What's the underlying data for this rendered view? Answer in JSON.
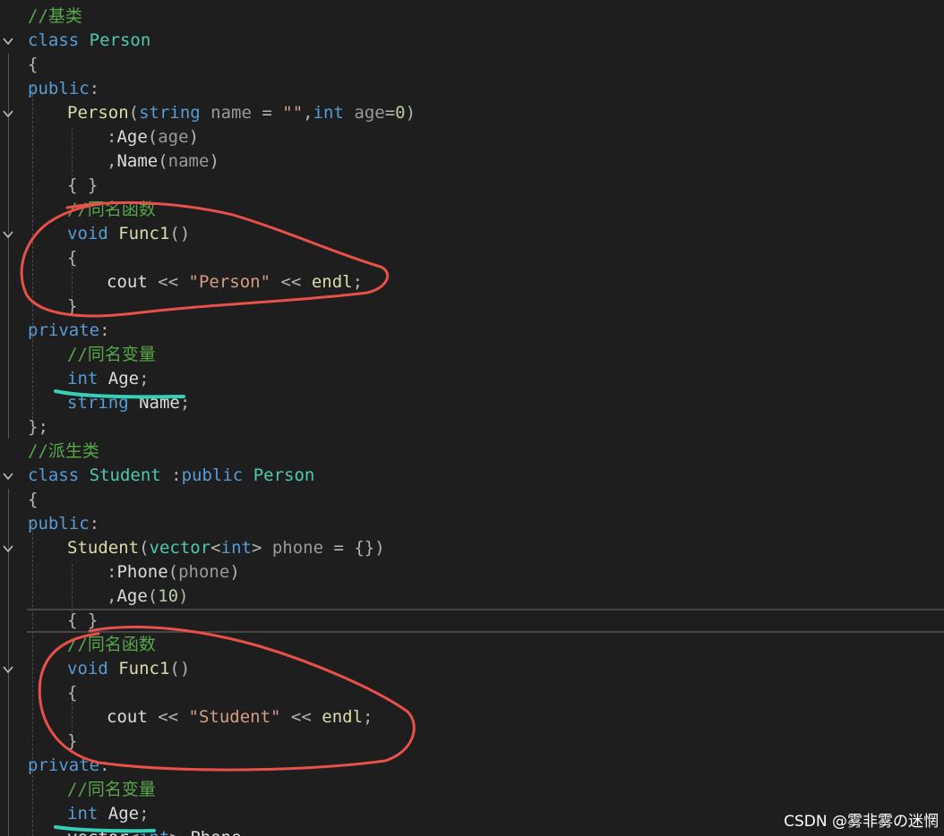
{
  "watermark": "CSDN @雾非雾の迷惘",
  "lines": [
    {
      "fold": false,
      "indent": 0,
      "tokens": [
        [
          "c-comment",
          "//基类"
        ]
      ]
    },
    {
      "fold": true,
      "indent": 0,
      "tokens": [
        [
          "c-kw",
          "class "
        ],
        [
          "c-type",
          "Person"
        ]
      ]
    },
    {
      "fold": false,
      "indent": 0,
      "tokens": [
        [
          "c-punc",
          "{"
        ]
      ]
    },
    {
      "fold": false,
      "indent": 0,
      "tokens": [
        [
          "c-kw",
          "public"
        ],
        [
          "c-punc",
          ":"
        ]
      ]
    },
    {
      "fold": true,
      "indent": 1,
      "tokens": [
        [
          "c-fn",
          "Person"
        ],
        [
          "c-punc",
          "("
        ],
        [
          "c-kw",
          "string"
        ],
        [
          "c-param",
          " name"
        ],
        [
          "c-punc",
          " = "
        ],
        [
          "c-str",
          "\"\""
        ],
        [
          "c-punc",
          ","
        ],
        [
          "c-kw",
          "int"
        ],
        [
          "c-param",
          " age"
        ],
        [
          "c-punc",
          "="
        ],
        [
          "c-num",
          "0"
        ],
        [
          "c-punc",
          ")"
        ]
      ]
    },
    {
      "fold": false,
      "indent": 2,
      "tokens": [
        [
          "c-punc",
          ":"
        ],
        [
          "c-plain",
          "Age"
        ],
        [
          "c-punc",
          "("
        ],
        [
          "c-param",
          "age"
        ],
        [
          "c-punc",
          ")"
        ]
      ]
    },
    {
      "fold": false,
      "indent": 2,
      "tokens": [
        [
          "c-punc",
          ","
        ],
        [
          "c-plain",
          "Name"
        ],
        [
          "c-punc",
          "("
        ],
        [
          "c-param",
          "name"
        ],
        [
          "c-punc",
          ")"
        ]
      ]
    },
    {
      "fold": false,
      "indent": 1,
      "tokens": [
        [
          "c-punc",
          "{ }"
        ]
      ]
    },
    {
      "fold": false,
      "indent": 1,
      "tokens": [
        [
          "c-comment",
          "//同名函数"
        ]
      ]
    },
    {
      "fold": true,
      "indent": 1,
      "tokens": [
        [
          "c-kw",
          "void "
        ],
        [
          "c-fn",
          "Func1"
        ],
        [
          "c-punc",
          "()"
        ]
      ]
    },
    {
      "fold": false,
      "indent": 1,
      "tokens": [
        [
          "c-punc",
          "{"
        ]
      ]
    },
    {
      "fold": false,
      "indent": 2,
      "tokens": [
        [
          "c-plain",
          "cout "
        ],
        [
          "c-punc",
          "<< "
        ],
        [
          "c-str",
          "\"Person\""
        ],
        [
          "c-punc",
          " << "
        ],
        [
          "c-fn",
          "endl"
        ],
        [
          "c-punc",
          ";"
        ]
      ]
    },
    {
      "fold": false,
      "indent": 1,
      "tokens": [
        [
          "c-punc",
          "}"
        ]
      ]
    },
    {
      "fold": false,
      "indent": 0,
      "tokens": [
        [
          "c-kw",
          "private"
        ],
        [
          "c-punc",
          ":"
        ]
      ]
    },
    {
      "fold": false,
      "indent": 1,
      "tokens": [
        [
          "c-comment",
          "//同名变量"
        ]
      ]
    },
    {
      "fold": false,
      "indent": 1,
      "tokens": [
        [
          "c-kw",
          "int "
        ],
        [
          "c-plain",
          "Age"
        ],
        [
          "c-punc",
          ";"
        ]
      ]
    },
    {
      "fold": false,
      "indent": 1,
      "tokens": [
        [
          "c-kw",
          "string "
        ],
        [
          "c-plain",
          "Name"
        ],
        [
          "c-punc",
          ";"
        ]
      ]
    },
    {
      "fold": false,
      "indent": 0,
      "tokens": [
        [
          "c-punc",
          "};"
        ]
      ]
    },
    {
      "fold": false,
      "indent": 0,
      "tokens": [
        [
          "c-comment",
          "//派生类"
        ]
      ]
    },
    {
      "fold": true,
      "indent": 0,
      "tokens": [
        [
          "c-kw",
          "class "
        ],
        [
          "c-type",
          "Student "
        ],
        [
          "c-punc",
          ":"
        ],
        [
          "c-kw",
          "public "
        ],
        [
          "c-type",
          "Person"
        ]
      ]
    },
    {
      "fold": false,
      "indent": 0,
      "tokens": [
        [
          "c-punc",
          "{"
        ]
      ]
    },
    {
      "fold": false,
      "indent": 0,
      "tokens": [
        [
          "c-kw",
          "public"
        ],
        [
          "c-punc",
          ":"
        ]
      ]
    },
    {
      "fold": true,
      "indent": 1,
      "tokens": [
        [
          "c-fn",
          "Student"
        ],
        [
          "c-punc",
          "("
        ],
        [
          "c-type",
          "vector"
        ],
        [
          "c-punc",
          "<"
        ],
        [
          "c-kw",
          "int"
        ],
        [
          "c-punc",
          "> "
        ],
        [
          "c-param",
          "phone"
        ],
        [
          "c-punc",
          " = {})"
        ]
      ]
    },
    {
      "fold": false,
      "indent": 2,
      "tokens": [
        [
          "c-punc",
          ":"
        ],
        [
          "c-plain",
          "Phone"
        ],
        [
          "c-punc",
          "("
        ],
        [
          "c-param",
          "phone"
        ],
        [
          "c-punc",
          ")"
        ]
      ]
    },
    {
      "fold": false,
      "indent": 2,
      "tokens": [
        [
          "c-punc",
          ","
        ],
        [
          "c-plain",
          "Age"
        ],
        [
          "c-punc",
          "("
        ],
        [
          "c-num",
          "10"
        ],
        [
          "c-punc",
          ")"
        ]
      ]
    },
    {
      "fold": false,
      "indent": 1,
      "current": true,
      "tokens": [
        [
          "c-punc",
          "{ }"
        ]
      ]
    },
    {
      "fold": false,
      "indent": 1,
      "tokens": [
        [
          "c-comment",
          "//同名函数"
        ]
      ]
    },
    {
      "fold": true,
      "indent": 1,
      "tokens": [
        [
          "c-kw",
          "void "
        ],
        [
          "c-fn",
          "Func1"
        ],
        [
          "c-punc",
          "()"
        ]
      ]
    },
    {
      "fold": false,
      "indent": 1,
      "tokens": [
        [
          "c-punc",
          "{"
        ]
      ]
    },
    {
      "fold": false,
      "indent": 2,
      "tokens": [
        [
          "c-plain",
          "cout "
        ],
        [
          "c-punc",
          "<< "
        ],
        [
          "c-str",
          "\"Student\""
        ],
        [
          "c-punc",
          " << "
        ],
        [
          "c-fn",
          "endl"
        ],
        [
          "c-punc",
          ";"
        ]
      ]
    },
    {
      "fold": false,
      "indent": 1,
      "tokens": [
        [
          "c-punc",
          "}"
        ]
      ]
    },
    {
      "fold": false,
      "indent": 0,
      "tokens": [
        [
          "c-kw",
          "private"
        ],
        [
          "c-punc",
          ":"
        ]
      ]
    },
    {
      "fold": false,
      "indent": 1,
      "tokens": [
        [
          "c-comment",
          "//同名变量"
        ]
      ]
    },
    {
      "fold": false,
      "indent": 1,
      "tokens": [
        [
          "c-kw",
          "int "
        ],
        [
          "c-plain",
          "Age"
        ],
        [
          "c-punc",
          ";"
        ]
      ]
    },
    {
      "fold": false,
      "indent": 1,
      "tokens": [
        [
          "c-plain",
          "vector"
        ],
        [
          "c-punc",
          "<"
        ],
        [
          "c-kw",
          "int"
        ],
        [
          "c-punc",
          "> "
        ],
        [
          "c-plain",
          "Phone"
        ]
      ]
    }
  ]
}
